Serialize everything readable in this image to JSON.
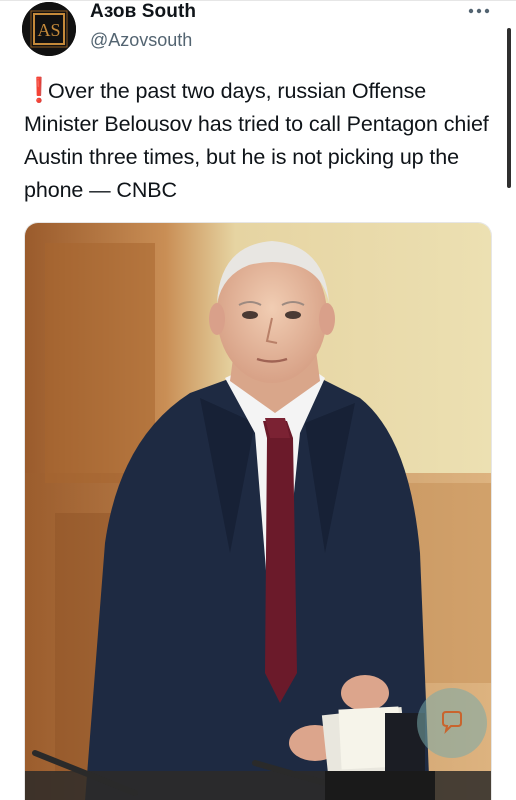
{
  "tweet": {
    "display_name": "Азов South",
    "handle": "@Azovsouth",
    "avatar_text": "AS",
    "alert_icon": "red-exclamation-icon",
    "body": "Over the past two days, russian Offense Minister Belousov has tried to call Pentagon chief Austin three times, but he is not picking up the phone — CNBC"
  },
  "media": {
    "subject": "photo-of-man-in-suit-at-podium"
  },
  "icons": {
    "more": "more-options-icon",
    "chat": "chat-bubble-icon"
  },
  "colors": {
    "alert": "#e0191f",
    "text": "#0f1419",
    "secondary": "#536471",
    "avatar_bg": "#111111",
    "avatar_accent": "#c58a3a"
  }
}
